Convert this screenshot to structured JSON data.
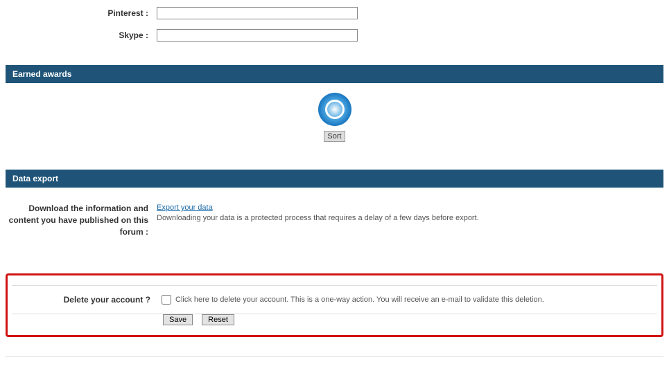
{
  "fields": {
    "pinterest": {
      "label": "Pinterest :",
      "value": ""
    },
    "skype": {
      "label": "Skype :",
      "value": ""
    }
  },
  "sections": {
    "awards": {
      "title": "Earned awards",
      "sort_label": "Sort"
    },
    "export": {
      "title": "Data export",
      "label": "Download the information and content you have published on this forum :",
      "link_text": "Export your data",
      "description": "Downloading your data is a protected process that requires a delay of a few days before export."
    }
  },
  "delete": {
    "label": "Delete your account ?",
    "description": "Click here to delete your account. This is a one-way action. You will receive an e-mail to validate this deletion."
  },
  "buttons": {
    "save": "Save",
    "reset": "Reset"
  }
}
